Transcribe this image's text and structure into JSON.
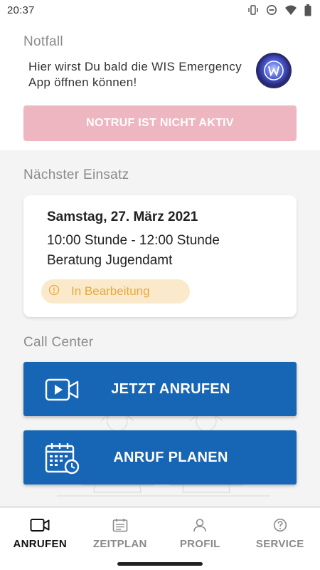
{
  "status_bar": {
    "time": "20:37",
    "icons": [
      "vibrate-icon",
      "do-not-disturb-icon",
      "wifi-icon",
      "battery-icon"
    ]
  },
  "notfall": {
    "title": "Notfall",
    "text": "Hier wirst Du bald die WIS Emergency App öffnen können!",
    "logo": "wis-emergency-logo",
    "notruf_button_label": "NOTRUF IST NICHT AKTIV",
    "notruf_button_color": "#eeb6c1"
  },
  "einsatz": {
    "title": "Nächster Einsatz",
    "date": "Samstag, 27. März 2021",
    "time": "10:00 Stunde - 12:00 Stunde",
    "description": "Beratung Jugendamt",
    "status": "In Bearbeitung",
    "status_color": "#e9a83c"
  },
  "call_center": {
    "title": "Call Center",
    "call_now_label": "JETZT ANRUFEN",
    "call_now_icon": "video-camera-icon",
    "schedule_label": "ANRUF PLANEN",
    "schedule_icon": "calendar-clock-icon",
    "button_color": "#1766b5"
  },
  "bottom_nav": {
    "items": [
      {
        "label": "ANRUFEN",
        "icon": "video-camera-icon",
        "active": true
      },
      {
        "label": "ZEITPLAN",
        "icon": "schedule-icon",
        "active": false
      },
      {
        "label": "PROFIL",
        "icon": "person-icon",
        "active": false
      },
      {
        "label": "SERVICE",
        "icon": "help-circle-icon",
        "active": false
      }
    ]
  }
}
